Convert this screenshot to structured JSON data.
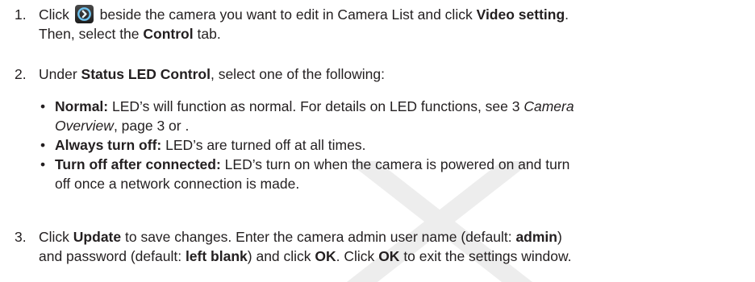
{
  "step1": {
    "number": "1.",
    "t1": "Click",
    "icon": "camera-settings-icon",
    "t2": "beside the camera you want to edit in Camera List and click",
    "b1": "Video setting",
    "t3": ".",
    "t4": "Then, select the",
    "b2": "Control",
    "t5": "tab."
  },
  "step2": {
    "number": "2.",
    "t1": "Under",
    "b1": "Status LED Control",
    "t2": ", select one of the following:",
    "options": [
      {
        "label": "Normal:",
        "text1": "LED’s will function as normal. For details on LED functions, see 3",
        "italic1": "Camera",
        "italic2": "Overview",
        "text2": ", page 3 or ."
      },
      {
        "label": "Always turn off:",
        "text1": "LED’s are turned off at all times."
      },
      {
        "label": "Turn off after connected:",
        "text1": "LED’s turn on when the camera is powered on and turn",
        "text2": "off once a network connection is made."
      }
    ]
  },
  "step3": {
    "number": "3.",
    "t1": "Click",
    "b1": "Update",
    "t2": "to save changes. Enter the camera admin user name (default:",
    "b2": "admin",
    "t3": ")",
    "t4": "and password (default:",
    "b3": "left blank",
    "t5": ") and click",
    "b4": "OK",
    "t6": ". Click",
    "b5": "OK",
    "t7": "to exit the settings window."
  },
  "colors": {
    "text": "#231f20",
    "icon_ring": "#6ec3f0",
    "watermark": "#ececec"
  }
}
